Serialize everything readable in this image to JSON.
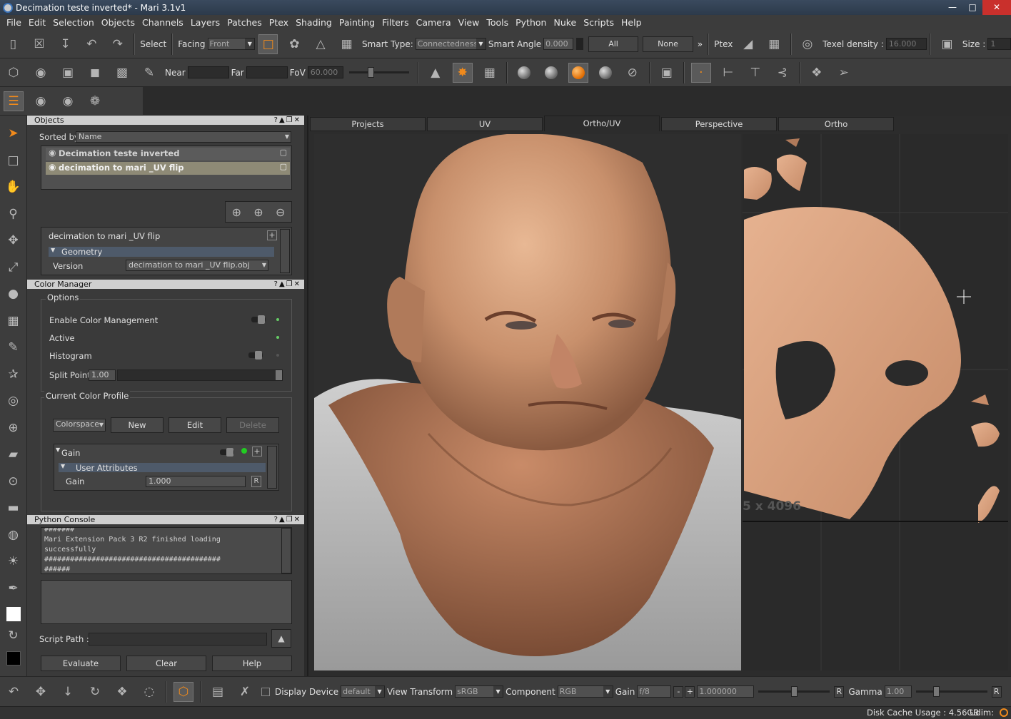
{
  "window": {
    "title": "Decimation teste inverted* - Mari 3.1v1"
  },
  "menu": [
    "File",
    "Edit",
    "Selection",
    "Objects",
    "Channels",
    "Layers",
    "Patches",
    "Ptex",
    "Shading",
    "Painting",
    "Filters",
    "Camera",
    "View",
    "Tools",
    "Python",
    "Nuke",
    "Scripts",
    "Help"
  ],
  "toolbar1": {
    "select_label": "Select",
    "facing_label": "Facing",
    "facing_value": "Front",
    "smart_type_label": "Smart Type:",
    "smart_type_value": "Connectedness",
    "smart_angle_label": "Smart Angle",
    "smart_angle_value": "0.000",
    "all_button": "All",
    "none_button": "None",
    "more": "»",
    "ptex_label": "Ptex",
    "texel_density_label": "Texel density :",
    "texel_density_value": "16.000",
    "size_label": "Size :",
    "size_value": "1"
  },
  "toolbar2": {
    "near_label": "Near",
    "far_label": "Far",
    "fov_label": "FoV",
    "fov_value": "60.000"
  },
  "objects_panel": {
    "title": "Objects",
    "sorted_by_label": "Sorted by",
    "sorted_by_value": "Name",
    "items": [
      {
        "name": "Decimation teste inverted"
      },
      {
        "name": "decimation to mari _UV flip"
      }
    ],
    "selected_object": "decimation to mari _UV flip",
    "geometry_label": "Geometry",
    "version_label": "Version",
    "version_value": "decimation to mari _UV flip.obj"
  },
  "color_manager": {
    "title": "Color Manager",
    "options_label": "Options",
    "enable_color_management": "Enable Color Management",
    "active": "Active",
    "histogram": "Histogram",
    "split_point_label": "Split Point",
    "split_point_value": "1.00",
    "current_profile_label": "Current Color Profile",
    "colorspace_value": "Colorspace",
    "new_button": "New",
    "edit_button": "Edit",
    "delete_button": "Delete",
    "gain_section": "Gain",
    "user_attributes": "User Attributes",
    "gain_label": "Gain",
    "gain_value": "1.000",
    "reset": "R"
  },
  "python_console": {
    "title": "Python Console",
    "output_lines": [
      "#######",
      "Mari Extension Pack 3 R2 finished loading",
      "successfully",
      "#########################################",
      "######"
    ],
    "script_path_label": "Script Path :",
    "evaluate_button": "Evaluate",
    "clear_button": "Clear",
    "help_button": "Help"
  },
  "viewport": {
    "tabs": [
      "Projects",
      "UV",
      "Ortho/UV",
      "Perspective",
      "Ortho"
    ],
    "active_tab": "Ortho/UV",
    "uv_resolution_text": "5 x 4096"
  },
  "bottombar": {
    "display_device_label": "Display Device",
    "display_device_value": "default",
    "view_transform_label": "View Transform",
    "view_transform_value": "sRGB",
    "component_label": "Component",
    "component_value": "RGB",
    "gain_label": "Gain",
    "gain_mode": "f/8",
    "minus": "-",
    "plus": "+",
    "gain_value": "1.000000",
    "gamma_label": "Gamma",
    "gamma_value": "1.00",
    "reset": "R"
  },
  "status": {
    "disk_cache": "Disk Cache Usage : 4.56GB",
    "udim": "Udim:"
  },
  "colors": {
    "skin": "#d9a27f",
    "accent_orange": "#f08a1c",
    "panel_bg": "#3a3a3a"
  }
}
